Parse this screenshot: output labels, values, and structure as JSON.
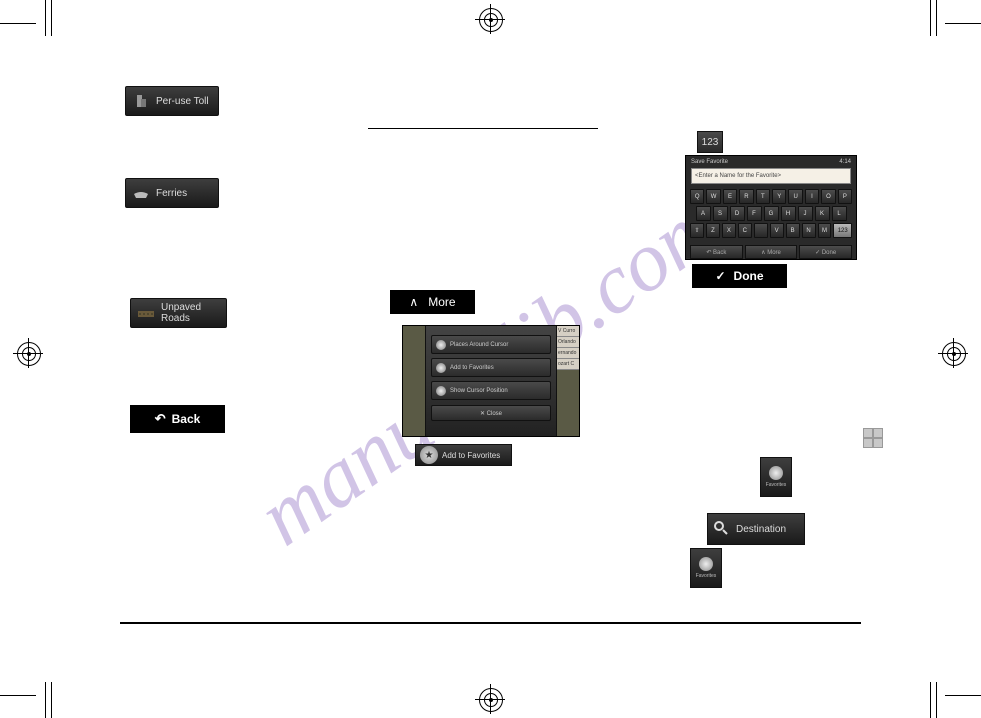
{
  "watermark": "manualslib.com",
  "badge123": "123",
  "buttons": {
    "peruse_toll": "Per-use Toll",
    "ferries": "Ferries",
    "unpaved": "Unpaved Roads",
    "back": "Back",
    "more": "More",
    "done": "Done",
    "add_fav": "Add to Favorites",
    "destination": "Destination",
    "favorites": "Favorites"
  },
  "map_popup": {
    "header": "",
    "rows": [
      "Places Around Cursor",
      "Add to Favorites",
      "Show Cursor Position"
    ],
    "close": "✕ Close",
    "sidelabels": [
      "V Curro",
      "Orlando",
      "ernando",
      "ozart C"
    ]
  },
  "keyboard": {
    "title": "Save Favorite",
    "time": "4:14",
    "placeholder": "<Enter a Name for the Favorite>",
    "row1": [
      "Q",
      "W",
      "E",
      "R",
      "T",
      "Y",
      "U",
      "I",
      "O",
      "P"
    ],
    "row2": [
      "A",
      "S",
      "D",
      "F",
      "G",
      "H",
      "J",
      "K",
      "L"
    ],
    "row3": [
      "⇧",
      "Z",
      "X",
      "C",
      "",
      "V",
      "B",
      "N",
      "M",
      "123"
    ],
    "bottom": [
      "↶ Back",
      "∧ More",
      "✓ Done"
    ]
  }
}
